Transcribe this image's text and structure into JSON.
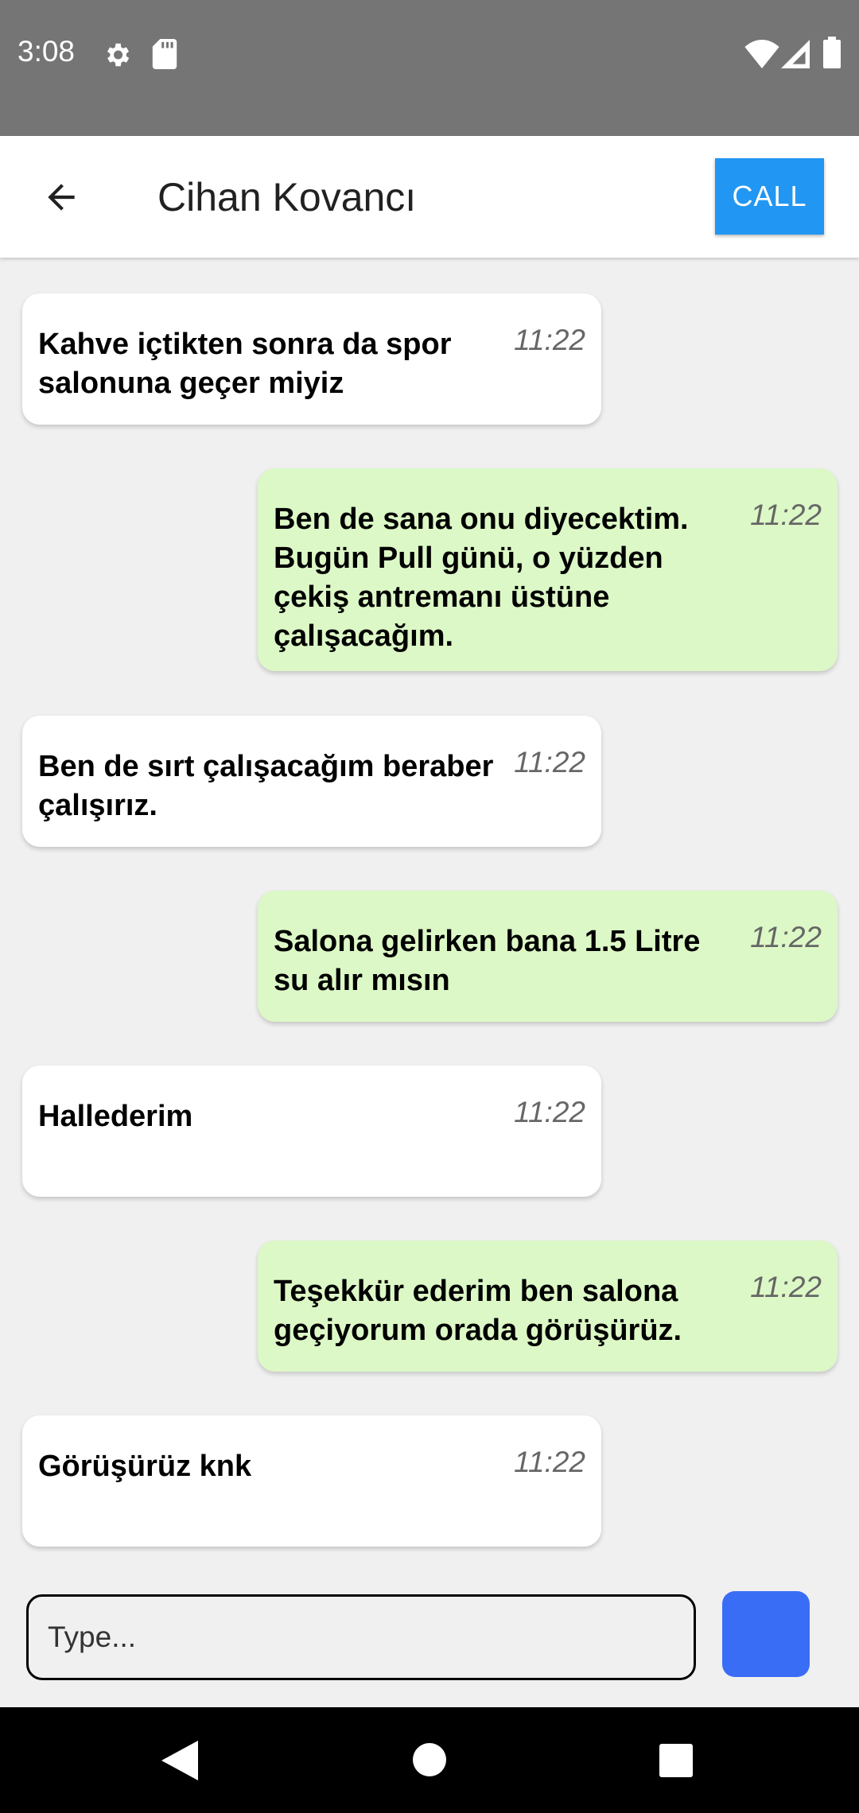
{
  "status_bar": {
    "time": "3:08",
    "icons": [
      "gear-icon",
      "sd-card-icon",
      "wifi-icon",
      "signal-icon",
      "battery-icon"
    ]
  },
  "header": {
    "contact_name": "Cihan Kovancı",
    "call_label": "CALL",
    "back_icon": "arrow-left-icon"
  },
  "messages": [
    {
      "direction": "in",
      "text": "Kahve içtikten sonra da spor salonuna geçer miyiz",
      "time": "11:22"
    },
    {
      "direction": "out",
      "text": "Ben de sana onu diyecektim. Bugün Pull günü, o yüzden çekiş antremanı üstüne çalışacağım.",
      "time": "11:22"
    },
    {
      "direction": "in",
      "text": "Ben de sırt çalışacağım beraber çalışırız.",
      "time": "11:22"
    },
    {
      "direction": "out",
      "text": "Salona gelirken bana 1.5 Litre su alır mısın",
      "time": "11:22"
    },
    {
      "direction": "in",
      "text": "Hallederim",
      "time": "11:22"
    },
    {
      "direction": "out",
      "text": "Teşekkür ederim ben salona geçiyorum orada görüşürüz.",
      "time": "11:22"
    },
    {
      "direction": "in",
      "text": "Görüşürüz knk",
      "time": "11:22"
    }
  ],
  "composer": {
    "placeholder": "Type...",
    "value": ""
  },
  "colors": {
    "status_bar": "#757575",
    "call_button": "#2196f3",
    "incoming_bubble": "#ffffff",
    "outgoing_bubble": "#dcf8c6",
    "send_button": "#3a6df6",
    "background": "#f0f0f0"
  }
}
